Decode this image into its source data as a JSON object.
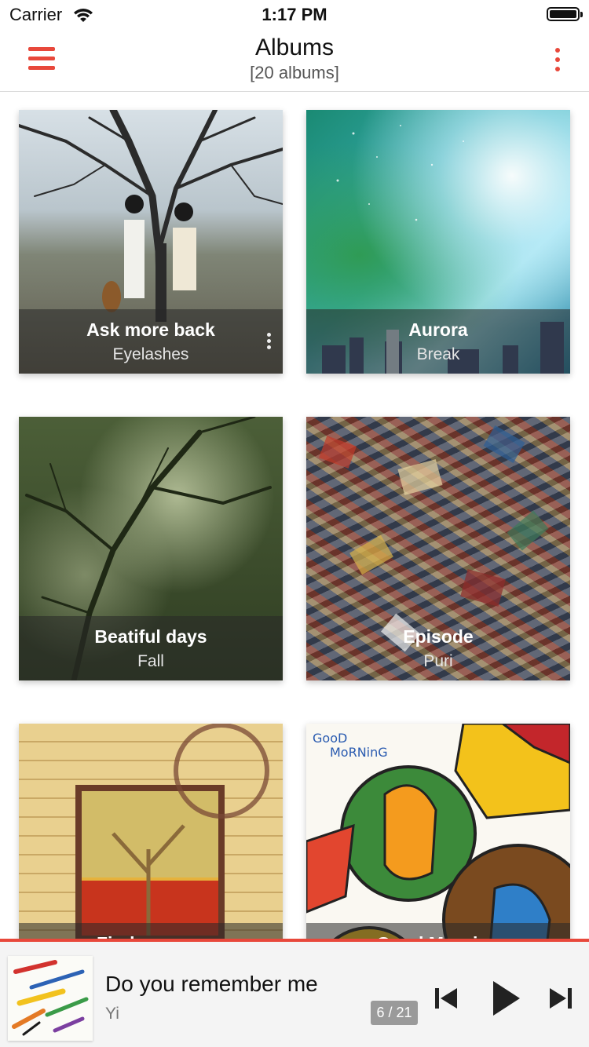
{
  "status_bar": {
    "carrier": "Carrier",
    "time": "1:17 PM",
    "icons": [
      "wifi-icon",
      "battery-icon"
    ]
  },
  "navbar": {
    "title": "Albums",
    "subtitle": "[20 albums]",
    "left_icon": "hamburger-menu-icon",
    "right_icon": "more-vertical-icon",
    "accent_color": "#e8483b"
  },
  "albums": [
    {
      "title": "Ask more back",
      "artist": "Eyelashes"
    },
    {
      "title": "Aurora",
      "artist": "Break"
    },
    {
      "title": "Beatiful days",
      "artist": "Fall"
    },
    {
      "title": "Episode",
      "artist": "Puri"
    },
    {
      "title": "Find my way",
      "artist": ""
    },
    {
      "title": "Good Morning",
      "artist": ""
    }
  ],
  "player": {
    "track": "Do you remember me",
    "artist": "Yi",
    "counter": "6 / 21",
    "controls": [
      "skip-previous-icon",
      "play-icon",
      "skip-next-icon"
    ]
  }
}
